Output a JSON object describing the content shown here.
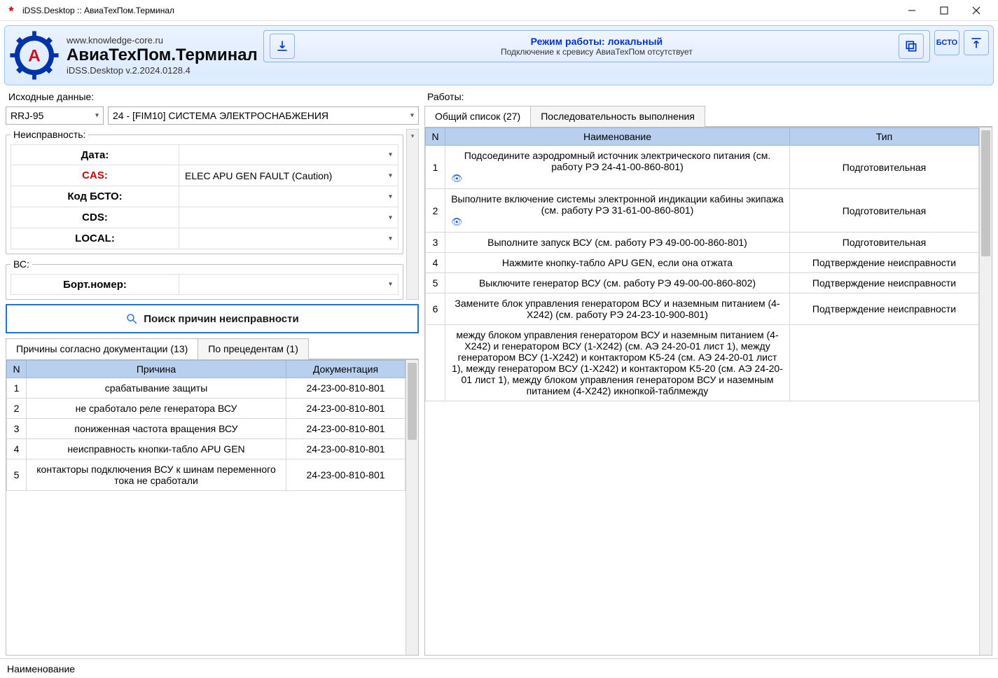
{
  "window": {
    "title": "iDSS.Desktop :: АвиаТехПом.Терминал"
  },
  "header": {
    "url": "www.knowledge-core.ru",
    "title": "АвиаТехПом.Терминал",
    "version": "iDSS.Desktop v.2.2024.0128.4",
    "status_mode": "Режим работы: локальный",
    "status_sub": "Подключение к сревису АвиаТехПом отсутствует",
    "bsto_btn": "БСТО"
  },
  "input": {
    "section_label": "Исходные данные:",
    "aircraft_select": "RRJ-95",
    "system_select": "24 - [FIM10] СИСТЕМА ЭЛЕКТРОСНАБЖЕНИЯ",
    "fault_group": "Неисправность:",
    "labels": {
      "date": "Дата:",
      "cas": "CAS:",
      "bsto": "Код БСТО:",
      "cds": "CDS:",
      "local": "LOCAL:"
    },
    "values": {
      "date": "",
      "cas": "ELEC APU GEN FAULT (Caution)",
      "bsto": "",
      "cds": "",
      "local": ""
    },
    "ac_group": "ВС:",
    "ac_labels": {
      "bort": "Борт.номер:"
    },
    "ac_values": {
      "bort": ""
    },
    "search_btn": "Поиск причин неисправности"
  },
  "causes": {
    "tab_docs": "Причины согласно документации (13)",
    "tab_prec": "По прецедентам (1)",
    "headers": {
      "n": "N",
      "cause": "Причина",
      "doc": "Документация"
    },
    "rows": [
      {
        "n": "1",
        "cause": "срабатывание защиты",
        "doc": "24-23-00-810-801"
      },
      {
        "n": "2",
        "cause": "не сработало реле генератора ВСУ",
        "doc": "24-23-00-810-801"
      },
      {
        "n": "3",
        "cause": "пониженная частота вращения ВСУ",
        "doc": "24-23-00-810-801"
      },
      {
        "n": "4",
        "cause": "неисправность кнопки-табло APU GEN",
        "doc": "24-23-00-810-801"
      },
      {
        "n": "5",
        "cause": "контакторы подключения ВСУ к шинам переменного тока не сработали",
        "doc": "24-23-00-810-801"
      }
    ]
  },
  "works": {
    "section_label": "Работы:",
    "tab_all": "Общий список (27)",
    "tab_seq": "Последовательность выполнения",
    "headers": {
      "n": "N",
      "name": "Наименование",
      "type": "Тип"
    },
    "rows": [
      {
        "n": "1",
        "name": "Подсоедините аэродромный источник электрического питания (см. работу РЭ 24-41-00-860-801)",
        "type": "Подготовительная",
        "eye": true
      },
      {
        "n": "2",
        "name": "Выполните включение системы электронной индикации кабины экипажа (см. работу РЭ 31-61-00-860-801)",
        "type": "Подготовительная",
        "eye": true
      },
      {
        "n": "3",
        "name": "Выполните запуск ВСУ (см. работу РЭ 49-00-00-860-801)",
        "type": "Подготовительная",
        "eye": false
      },
      {
        "n": "4",
        "name": "Нажмите кнопку-табло APU GEN, если она отжата",
        "type": "Подтверждение неисправности",
        "eye": false
      },
      {
        "n": "5",
        "name": "Выключите генератор ВСУ (см. работу РЭ 49-00-00-860-802)",
        "type": "Подтверждение неисправности",
        "eye": false
      },
      {
        "n": "6",
        "name": "Замените блок управления генератором ВСУ и наземным питанием (4-X242) (см. работу РЭ 24-23-10-900-801)",
        "type": "Подтверждение неисправности",
        "eye": false
      },
      {
        "n": "",
        "name": "между блоком управления генератором ВСУ и наземным питанием (4-X242) и генератором ВСУ (1-X242) (см. АЭ 24-20-01 лист 1), между генератором ВСУ (1-X242) и контактором K5-24 (см. АЭ 24-20-01 лист 1),  между генератором ВСУ (1-X242) и контактором K5-20 (см. АЭ 24-20-01 лист 1), между блоком управления генератором ВСУ и наземным питанием (4-X242) икнопкой-таблмежду",
        "type": "",
        "eye": false
      }
    ]
  },
  "footer": {
    "label": "Наименование"
  }
}
